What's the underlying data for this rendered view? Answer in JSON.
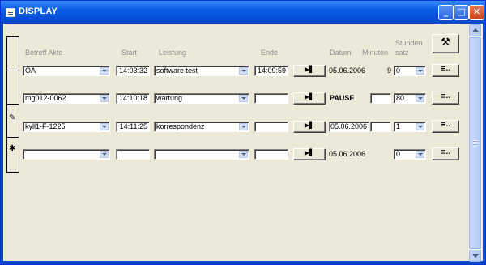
{
  "window": {
    "title": "DISPLAY"
  },
  "headers": {
    "betreff_akte": "Betreff Akte",
    "start": "Start",
    "leistung": "Leistung",
    "ende": "Ende",
    "datum": "Datum",
    "minuten": "Minuten",
    "stundensatz_line1": "Stunden",
    "stundensatz_line2": "satz"
  },
  "rows": [
    {
      "akte": "OA",
      "start": "14:03:32",
      "leistung": "software test",
      "ende": "14:09:59",
      "datum": "05.06.2006",
      "minuten": "9",
      "satz": "0",
      "selector": ""
    },
    {
      "akte": "mg012-0062",
      "start": "14:10:18",
      "leistung": "wartung",
      "ende": "",
      "datum": "PAUSE",
      "minuten": "",
      "satz": "80",
      "selector": "✎"
    },
    {
      "akte": "kyll1-F-1225",
      "start": "14:11:25",
      "leistung": "korrespondenz",
      "ende": "",
      "datum": "05.06.2006",
      "minuten": "",
      "satz": "1",
      "selector": ""
    },
    {
      "akte": "",
      "start": "",
      "leistung": "",
      "ende": "",
      "datum": "05.06.2006",
      "minuten": "",
      "satz": "0",
      "selector": "✱"
    }
  ],
  "icons": {
    "tools": "hammer-icon",
    "play": "play-pause-icon",
    "details": "details-icon"
  }
}
